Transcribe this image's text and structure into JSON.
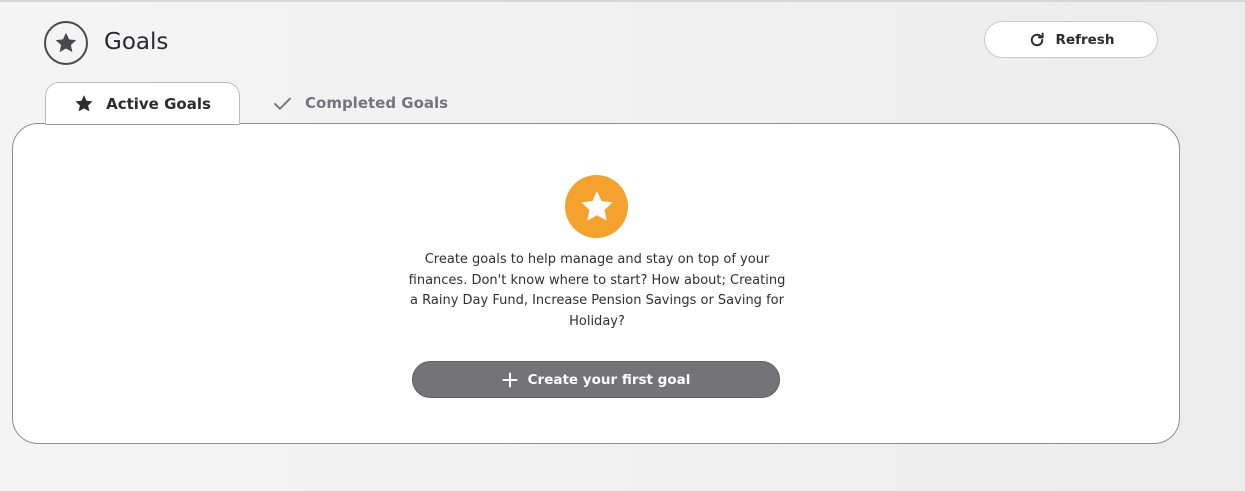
{
  "header": {
    "title": "Goals",
    "icon": "star-icon",
    "refresh_label": "Refresh",
    "refresh_icon": "refresh-icon"
  },
  "tabs": [
    {
      "label": "Active Goals",
      "icon": "star-icon",
      "active": true
    },
    {
      "label": "Completed Goals",
      "icon": "check-icon",
      "active": false
    }
  ],
  "empty_state": {
    "icon": "star-icon",
    "accent_color": "#f4a12e",
    "message": "Create goals to help manage and stay on top of your finances. Don't know where to start? How about; Creating a Rainy Day Fund, Increase Pension Savings or Saving for Holiday?",
    "button_label": "Create your first goal",
    "button_icon": "plus-icon"
  }
}
